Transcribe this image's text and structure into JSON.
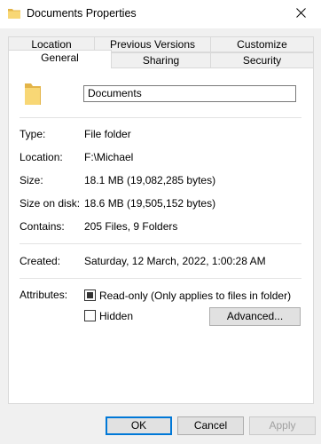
{
  "window": {
    "title": "Documents Properties",
    "close_glyph": "✕"
  },
  "tabs": {
    "row_top": [
      "Location",
      "Previous Versions",
      "Customize"
    ],
    "row_bottom": [
      "General",
      "Sharing",
      "Security"
    ],
    "selected": "General"
  },
  "general": {
    "folder_name": "Documents",
    "fields": [
      {
        "label": "Type:",
        "value": "File folder"
      },
      {
        "label": "Location:",
        "value": "F:\\Michael"
      },
      {
        "label": "Size:",
        "value": "18.1 MB (19,082,285 bytes)"
      },
      {
        "label": "Size on disk:",
        "value": "18.6 MB (19,505,152 bytes)"
      },
      {
        "label": "Contains:",
        "value": "205 Files, 9 Folders"
      }
    ],
    "created": {
      "label": "Created:",
      "value": "Saturday, 12 March, 2022, 1:00:28 AM"
    },
    "attributes": {
      "label": "Attributes:",
      "readonly_label": "Read-only (Only applies to files in folder)",
      "readonly_state": "indeterminate",
      "hidden_label": "Hidden",
      "hidden_state": "unchecked",
      "advanced_label": "Advanced..."
    }
  },
  "buttons": {
    "ok": "OK",
    "cancel": "Cancel",
    "apply": "Apply"
  },
  "icons": {
    "folder": "folder-icon",
    "title": "folder-title-icon",
    "close": "close-icon"
  },
  "colors": {
    "folder_yellow": "#f8d775",
    "folder_dark": "#e3b448",
    "default_border": "#0078d7"
  }
}
